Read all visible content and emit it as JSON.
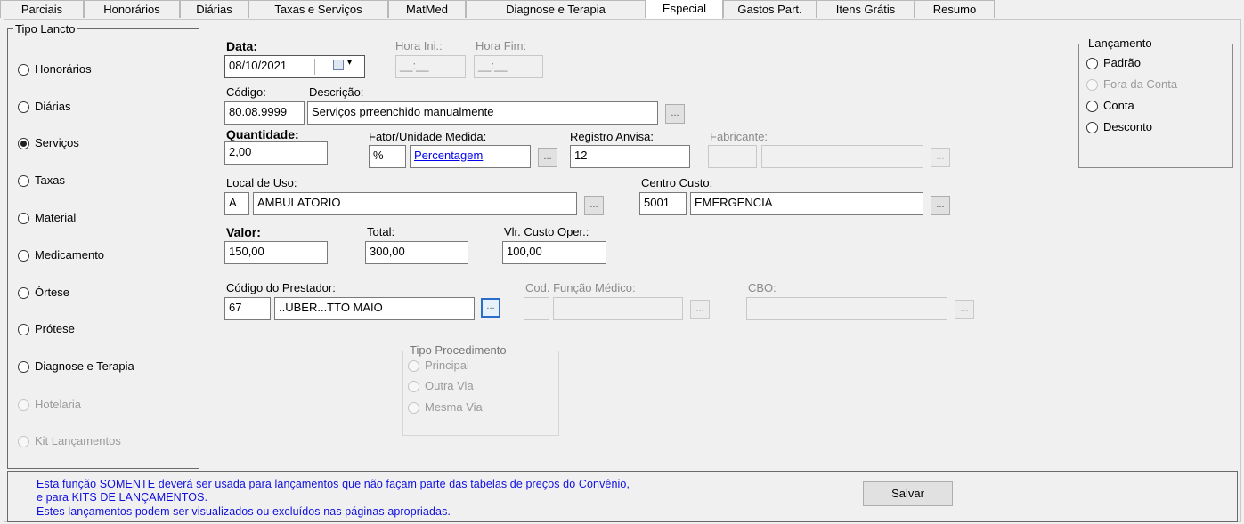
{
  "tabs": [
    "Parciais",
    "Honorários",
    "Diárias",
    "Taxas e Serviços",
    "MatMed",
    "Diagnose e Terapia",
    "Especial",
    "Gastos Part.",
    "Itens Grátis",
    "Resumo"
  ],
  "active_tab": "Especial",
  "tipo_lancto": {
    "title": "Tipo Lancto",
    "options": [
      {
        "label": "Honorários",
        "checked": false,
        "enabled": true
      },
      {
        "label": "Diárias",
        "checked": false,
        "enabled": true
      },
      {
        "label": "Serviços",
        "checked": true,
        "enabled": true
      },
      {
        "label": "Taxas",
        "checked": false,
        "enabled": true
      },
      {
        "label": "Material",
        "checked": false,
        "enabled": true
      },
      {
        "label": "Medicamento",
        "checked": false,
        "enabled": true
      },
      {
        "label": "Órtese",
        "checked": false,
        "enabled": true
      },
      {
        "label": "Prótese",
        "checked": false,
        "enabled": true
      },
      {
        "label": "Diagnose e Terapia",
        "checked": false,
        "enabled": true
      },
      {
        "label": "Hotelaria",
        "checked": false,
        "enabled": false
      },
      {
        "label": "Kit Lançamentos",
        "checked": false,
        "enabled": false
      }
    ]
  },
  "form": {
    "data_label": "Data:",
    "data_value": "08/10/2021",
    "hora_ini_label": "Hora Ini.:",
    "hora_ini_value": "__:__",
    "hora_fim_label": "Hora Fim:",
    "hora_fim_value": "__:__",
    "codigo_label": "Código:",
    "codigo_value": "80.08.9999",
    "descricao_label": "Descrição:",
    "descricao_value": "Serviços  prreenchido manualmente",
    "quantidade_label": "Quantidade:",
    "quantidade_value": "2,00",
    "fator_label": "Fator/Unidade Medida:",
    "fator_value": "%",
    "fator_link": "Percentagem",
    "registro_label": "Registro Anvisa:",
    "registro_value": "12",
    "fabricante_label": "Fabricante:",
    "fabricante_code": "",
    "fabricante_name": "",
    "local_label": "Local de Uso:",
    "local_code": "A",
    "local_name": "AMBULATORIO",
    "centro_label": "Centro Custo:",
    "centro_code": "5001",
    "centro_name": "EMERGENCIA",
    "valor_label": "Valor:",
    "valor_value": "150,00",
    "total_label": "Total:",
    "total_value": "300,00",
    "custo_label": "Vlr. Custo Oper.:",
    "custo_value": "100,00",
    "prestador_label": "Código do Prestador:",
    "prestador_code": "67",
    "prestador_name": "..UBER...TTO MAIO",
    "funcao_label": "Cod. Função Médico:",
    "funcao_code": "",
    "funcao_name": "",
    "cbo_label": "CBO:",
    "cbo_value": "",
    "ellipsis": "..."
  },
  "tipo_procedimento": {
    "title": "Tipo Procedimento",
    "options": [
      "Principal",
      "Outra Via",
      "Mesma Via"
    ]
  },
  "lancamento": {
    "title": "Lançamento",
    "options": [
      {
        "label": "Padrão",
        "enabled": true
      },
      {
        "label": "Fora da Conta",
        "enabled": false
      },
      {
        "label": "Conta",
        "enabled": true
      },
      {
        "label": "Desconto",
        "enabled": true
      }
    ]
  },
  "footer": {
    "line1": "Esta função SOMENTE deverá ser usada  para lançamentos que não façam parte das tabelas de preços do Convênio,",
    "line2": "e para  KITS DE LANÇAMENTOS.",
    "line3": "Estes lançamentos podem ser visualizados ou   excluídos nas páginas apropriadas.",
    "save_label": "Salvar"
  },
  "colors": {
    "info_text": "#1010e0",
    "link": "#0000ee",
    "focus_border": "#2a6ec9"
  }
}
